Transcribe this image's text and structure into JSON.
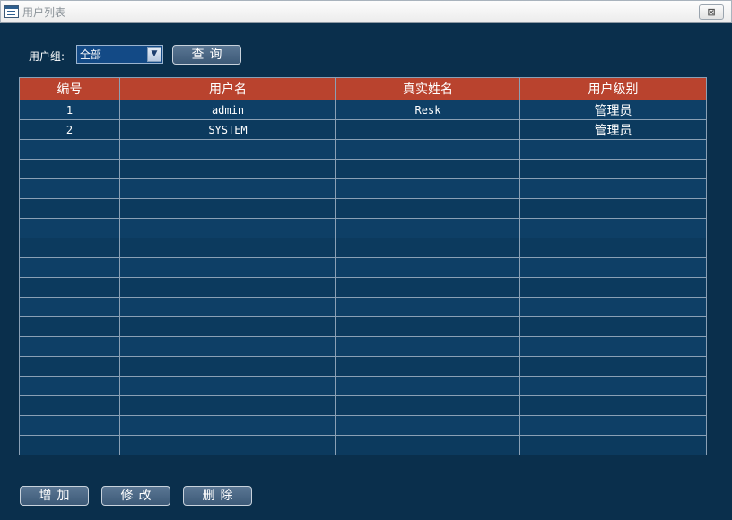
{
  "window": {
    "title": "用户列表",
    "close_label": "⊠"
  },
  "filter": {
    "label": "用户组:",
    "selected": "全部"
  },
  "buttons": {
    "query": "查询",
    "add": "增加",
    "edit": "修改",
    "delete": "删除"
  },
  "table": {
    "columns": [
      "编号",
      "用户名",
      "真实姓名",
      "用户级别"
    ],
    "rows": [
      [
        "1",
        "admin",
        "Resk",
        "管理员"
      ],
      [
        "2",
        "SYSTEM",
        "",
        "管理员"
      ],
      [
        "",
        "",
        "",
        ""
      ],
      [
        "",
        "",
        "",
        ""
      ],
      [
        "",
        "",
        "",
        ""
      ],
      [
        "",
        "",
        "",
        ""
      ],
      [
        "",
        "",
        "",
        ""
      ],
      [
        "",
        "",
        "",
        ""
      ],
      [
        "",
        "",
        "",
        ""
      ],
      [
        "",
        "",
        "",
        ""
      ],
      [
        "",
        "",
        "",
        ""
      ],
      [
        "",
        "",
        "",
        ""
      ],
      [
        "",
        "",
        "",
        ""
      ],
      [
        "",
        "",
        "",
        ""
      ],
      [
        "",
        "",
        "",
        ""
      ],
      [
        "",
        "",
        "",
        ""
      ],
      [
        "",
        "",
        "",
        ""
      ],
      [
        "",
        "",
        "",
        ""
      ]
    ]
  },
  "colors": {
    "header_bg": "#b9432e",
    "grid_bg": "#0e3f66",
    "window_bg": "#0a2f4c"
  }
}
